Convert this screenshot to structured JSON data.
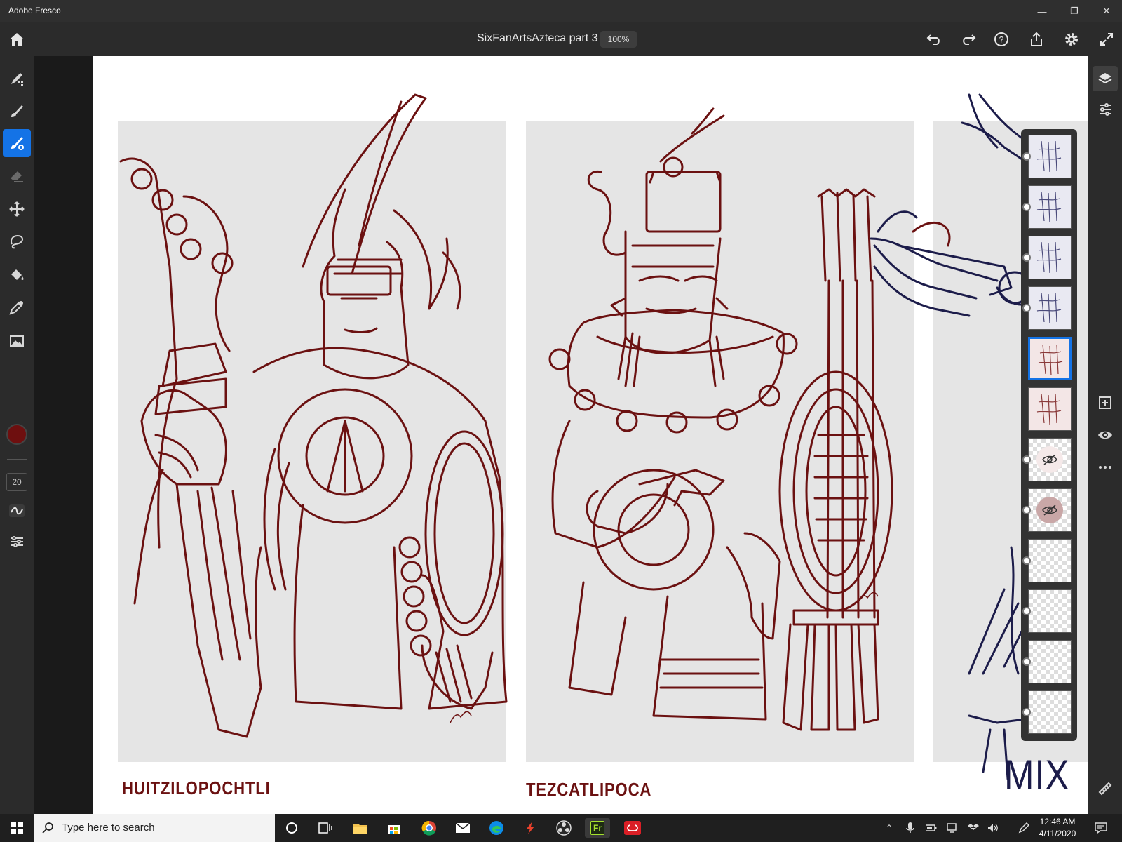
{
  "app": {
    "title": "Adobe Fresco"
  },
  "window_controls": [
    "minimize-icon",
    "restore-icon",
    "close-icon"
  ],
  "header": {
    "document_title": "SixFanArtsAzteca part 3",
    "zoom": "100%"
  },
  "header_icons": [
    "home-icon",
    "undo-icon",
    "redo-icon",
    "help-icon",
    "share-icon",
    "settings-icon",
    "fullscreen-icon"
  ],
  "tools": [
    "pixel-brush-icon",
    "live-brush-icon",
    "vector-brush-icon",
    "eraser-icon",
    "move-icon",
    "lasso-icon",
    "fill-icon",
    "eyedropper-icon",
    "image-icon"
  ],
  "active_tool": "vector-brush-icon",
  "brush": {
    "color": "#6e0f0f",
    "size": "20"
  },
  "artwork": {
    "captions": [
      "HUITZILOPOCHTLI",
      "TEZCATLIPOCA",
      "MIX"
    ],
    "line_color": "#6b1111",
    "sketch_color": "#1c1c4a"
  },
  "right_tools": [
    "layers-icon",
    "layer-properties-icon",
    "add-layer-icon",
    "visibility-icon",
    "more-icon",
    "ruler-icon"
  ],
  "layers": [
    {
      "type": "thumb",
      "tint": "#e9e9f2"
    },
    {
      "type": "thumb",
      "tint": "#e9e9f2"
    },
    {
      "type": "thumb",
      "tint": "#e9e9f2"
    },
    {
      "type": "thumb",
      "tint": "#e9e9f2"
    },
    {
      "type": "thumb",
      "tint": "#f3e6e6",
      "selected": true
    },
    {
      "type": "thumb",
      "tint": "#f3e6e6"
    },
    {
      "type": "hidden",
      "tint": "#f5e9e9"
    },
    {
      "type": "hidden",
      "tint": "#c9a7a7"
    },
    {
      "type": "empty"
    },
    {
      "type": "empty"
    },
    {
      "type": "empty"
    },
    {
      "type": "background"
    }
  ],
  "taskbar": {
    "search_placeholder": "Type here to search",
    "time": "12:46 AM",
    "date": "4/11/2020",
    "pinned": [
      "cortana-icon",
      "task-view-icon",
      "file-explorer-icon",
      "store-icon",
      "chrome-icon",
      "mail-icon",
      "edge-icon",
      "sketchbook-icon",
      "obs-icon",
      "fresco-icon",
      "creative-cloud-icon"
    ],
    "fresco_label": "Fr"
  },
  "colors": {
    "accent": "#1473e6"
  }
}
